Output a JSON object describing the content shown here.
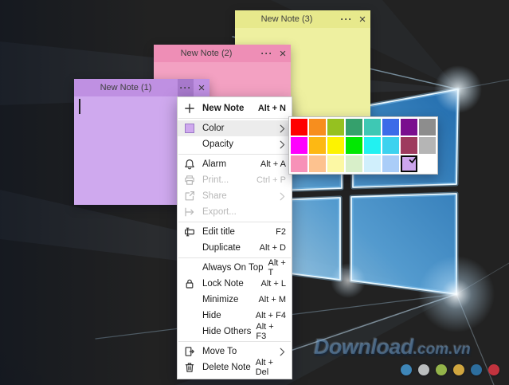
{
  "wallpaper": {
    "description": "Windows 10 hero wallpaper with glowing window logo",
    "colors": {
      "base_dark": "#0a2748",
      "glow_blue": "#2f8fd8",
      "pane_light": "#c6e9fb"
    }
  },
  "watermark": {
    "text_main": "Download",
    "text_suffix": ".com.vn",
    "dot_colors": [
      "#3e86b8",
      "#babdbe",
      "#94b44a",
      "#d0a63f",
      "#2d6e9e",
      "#c2333e"
    ]
  },
  "note_buttons": {
    "more_glyph": "···",
    "close_glyph": "×"
  },
  "notes": [
    {
      "title": "New Note (1)",
      "colors": {
        "title_bar": "#bf90e2",
        "body": "#cfa9ee"
      },
      "more_pressed": true,
      "caret": true
    },
    {
      "title": "New Note (2)",
      "colors": {
        "title_bar": "#ee8eb6",
        "body": "#f3a1c2"
      }
    },
    {
      "title": "New Note (3)",
      "colors": {
        "title_bar": "#e7e98c",
        "body": "#eef0a0"
      }
    }
  ],
  "context_menu": {
    "items": [
      {
        "label": "New Note",
        "shortcut": "Alt + N",
        "icon": "plus-icon",
        "bold": true
      },
      {
        "type": "separator"
      },
      {
        "label": "Color",
        "icon": "color-swatch-icon",
        "submenu": true,
        "highlighted": true
      },
      {
        "label": "Opacity",
        "submenu": true
      },
      {
        "type": "separator"
      },
      {
        "label": "Alarm",
        "shortcut": "Alt + A",
        "icon": "bell-icon"
      },
      {
        "label": "Print...",
        "shortcut": "Ctrl + P",
        "icon": "printer-icon",
        "disabled": true
      },
      {
        "label": "Share",
        "icon": "share-icon",
        "submenu": true,
        "disabled": true
      },
      {
        "label": "Export...",
        "icon": "export-icon",
        "disabled": true
      },
      {
        "type": "separator"
      },
      {
        "label": "Edit title",
        "shortcut": "F2",
        "icon": "rename-icon"
      },
      {
        "label": "Duplicate",
        "shortcut": "Alt + D"
      },
      {
        "type": "separator"
      },
      {
        "label": "Always On Top",
        "shortcut": "Alt + T"
      },
      {
        "label": "Lock Note",
        "shortcut": "Alt + L",
        "icon": "lock-icon"
      },
      {
        "label": "Minimize",
        "shortcut": "Alt + M"
      },
      {
        "label": "Hide",
        "shortcut": "Alt + F4"
      },
      {
        "label": "Hide Others",
        "shortcut": "Alt + F3"
      },
      {
        "type": "separator"
      },
      {
        "label": "Move To",
        "icon": "move-icon",
        "submenu": true
      },
      {
        "label": "Delete Note",
        "shortcut": "Alt + Del",
        "icon": "trash-icon"
      }
    ]
  },
  "color_palette": {
    "rows": [
      [
        "#fe0000",
        "#f78e1e",
        "#95c120",
        "#35a06c",
        "#3ec8b4",
        "#3b6be8",
        "#7a0e8e",
        "#8d8d8d"
      ],
      [
        "#fe00fe",
        "#fdb813",
        "#fdf300",
        "#02e802",
        "#22f1f1",
        "#3cd2ef",
        "#9e3a5e",
        "#b5b5b5"
      ],
      [
        "#f791b8",
        "#fdc28f",
        "#fcf8a4",
        "#d8efc9",
        "#d0effc",
        "#aacdf8",
        "#cda6ed",
        "#ffffff"
      ]
    ],
    "selected": {
      "row": 2,
      "col": 6
    },
    "selected_color": "#cda6ed"
  }
}
